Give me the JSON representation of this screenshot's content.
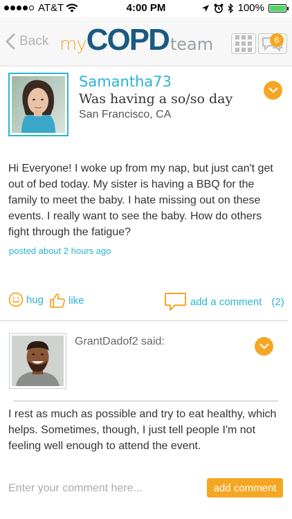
{
  "status_bar": {
    "carrier": "AT&T",
    "time": "4:00 PM",
    "battery": "100%",
    "battery_level": 1.0
  },
  "nav": {
    "back_label": "Back",
    "logo_my": "my",
    "logo_main": "COPD",
    "logo_team": "team",
    "notification_count": "6"
  },
  "post": {
    "username": "Samantha73",
    "title": "Was having a so/so day",
    "location": "San Francisco, CA",
    "body": "Hi Everyone! I woke up from my nap, but just can't get out of bed today. My sister is having a BBQ for the family to meet the baby. I hate missing out on these events. I really want to see the baby. How do others fight through the fatigue?",
    "posted": "posted about 2 hours ago"
  },
  "actions": {
    "hug": "hug",
    "like": "like",
    "add_comment": "add a comment",
    "comment_count": "(2)"
  },
  "comment": {
    "author": "GrantDadof2 said:",
    "body": "I rest as much as possible and try to eat healthy, which helps. Sometimes, though, I just tell people I'm not feeling well enough to attend the event."
  },
  "compose": {
    "placeholder": "Enter your comment here...",
    "button_label": "add comment"
  },
  "colors": {
    "accent_blue": "#2ab3d6",
    "accent_orange": "#f5a623",
    "logo_navy": "#1a5a82"
  },
  "icons": {
    "signal": "signal-dots-icon",
    "wifi": "wifi-icon",
    "location": "location-arrow-icon",
    "alarm": "alarm-icon",
    "bluetooth": "bluetooth-icon",
    "battery": "battery-icon",
    "back": "chevron-left-icon",
    "grid": "grid-icon",
    "messages": "chat-bubbles-icon",
    "hug": "smiley-icon",
    "like": "thumbs-up-icon",
    "comment": "speech-bubble-icon",
    "expand": "chevron-down-icon"
  }
}
